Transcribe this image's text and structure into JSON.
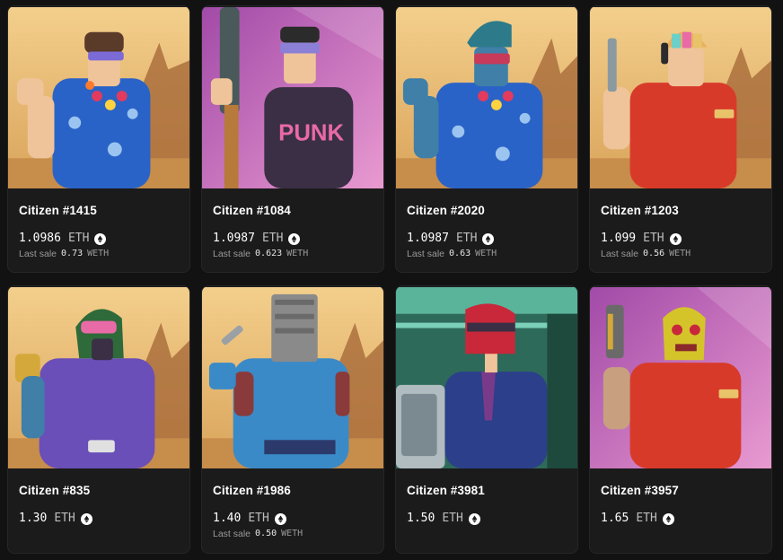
{
  "currency_icon": "ethereum-logo-icon",
  "colors": {
    "page_background": "#121212",
    "card_background": "#1b1b1b",
    "card_border": "#262626",
    "text_primary": "#ffffff",
    "text_secondary": "#9a9a9a"
  },
  "cards": [
    {
      "name": "Citizen #1415",
      "price": "1.0986",
      "currency": "ETH",
      "last_sale_label": "Last sale",
      "last_sale_value": "0.73",
      "last_sale_currency": "WETH",
      "image_subject": "man in blue floral shirt with flower lei and visor, desert background",
      "background": "desert"
    },
    {
      "name": "Citizen #1084",
      "price": "1.0987",
      "currency": "ETH",
      "last_sale_label": "Last sale",
      "last_sale_value": "0.623",
      "last_sale_currency": "WETH",
      "image_subject": "man in purple punk t-shirt with visor holding rocket launcher, pink city background",
      "background": "pink"
    },
    {
      "name": "Citizen #2020",
      "price": "1.0987",
      "currency": "ETH",
      "last_sale_label": "Last sale",
      "last_sale_value": "0.63",
      "last_sale_currency": "WETH",
      "image_subject": "blue-skinned character with pompadour in floral shirt and lei, desert background",
      "background": "desert"
    },
    {
      "name": "Citizen #1203",
      "price": "1.099",
      "currency": "ETH",
      "last_sale_label": "Last sale",
      "last_sale_value": "0.56",
      "last_sale_currency": "WETH",
      "image_subject": "man in red polo with headphones and rainbow helmet holding drill, desert background",
      "background": "desert"
    },
    {
      "name": "Citizen #835",
      "price": "1.30",
      "currency": "ETH",
      "image_subject": "character in green helmet with goggles and purple armor, desert background",
      "background": "desert"
    },
    {
      "name": "Citizen #1986",
      "price": "1.40",
      "currency": "ETH",
      "last_sale_label": "Last sale",
      "last_sale_value": "0.50",
      "last_sale_currency": "WETH",
      "image_subject": "character with bucket helmet in blue jacket holding wrench, desert background",
      "background": "desert"
    },
    {
      "name": "Citizen #3981",
      "price": "1.50",
      "currency": "ETH",
      "image_subject": "character in red helmet wearing blue suit, green interior background",
      "background": "green"
    },
    {
      "name": "Citizen #3957",
      "price": "1.65",
      "currency": "ETH",
      "image_subject": "gold skull mask character in red polo holding gun, pink background",
      "background": "pink"
    }
  ]
}
